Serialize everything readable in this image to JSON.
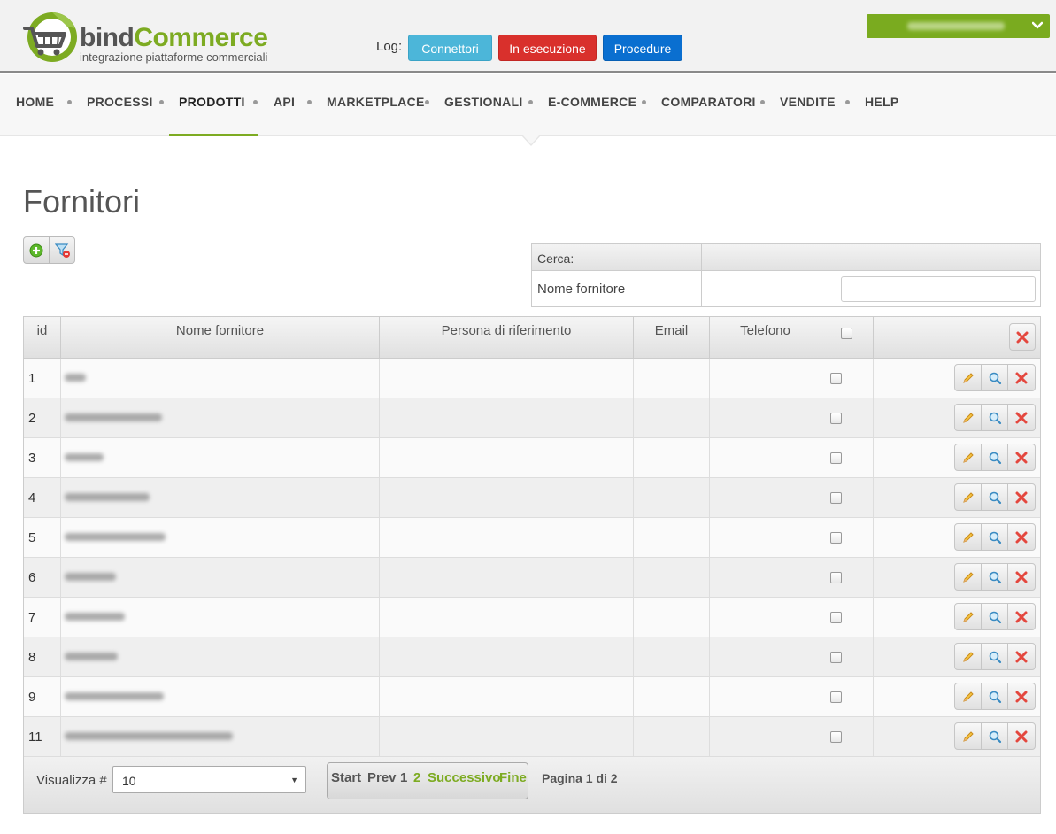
{
  "brand": {
    "name_part1": "bind",
    "name_part2": "Commerce",
    "tagline": "integrazione piattaforme commerciali",
    "colors": {
      "green": "#7dab22",
      "gray": "#555555"
    }
  },
  "header": {
    "log_label": "Log:",
    "buttons": {
      "connettori": "Connettori",
      "esecuzione": "In esecuzione",
      "procedure": "Procedure"
    },
    "account_icon": "chevron-down-icon"
  },
  "nav": {
    "items": [
      "HOME",
      "PROCESSI",
      "PRODOTTI",
      "API",
      "MARKETPLACE",
      "GESTIONALI",
      "E-COMMERCE",
      "COMPARATORI",
      "VENDITE",
      "HELP"
    ],
    "active": "PRODOTTI"
  },
  "page": {
    "title": "Fornitori"
  },
  "search": {
    "header": "Cerca:",
    "field_label": "Nome fornitore",
    "field_value": ""
  },
  "table": {
    "columns": [
      "id",
      "Nome fornitore",
      "Persona di riferimento",
      "Email",
      "Telefono"
    ],
    "rows": [
      {
        "id": "1"
      },
      {
        "id": "2"
      },
      {
        "id": "3"
      },
      {
        "id": "4"
      },
      {
        "id": "5"
      },
      {
        "id": "6"
      },
      {
        "id": "7"
      },
      {
        "id": "8"
      },
      {
        "id": "9"
      },
      {
        "id": "11"
      }
    ]
  },
  "footer": {
    "visualizza_label": "Visualizza #",
    "page_size": "10",
    "pager": {
      "start": "Start",
      "prev": "Prev",
      "page1": "1",
      "page2": "2",
      "next": "Successivo",
      "end": "Fine"
    },
    "page_info": "Pagina 1 di 2"
  }
}
